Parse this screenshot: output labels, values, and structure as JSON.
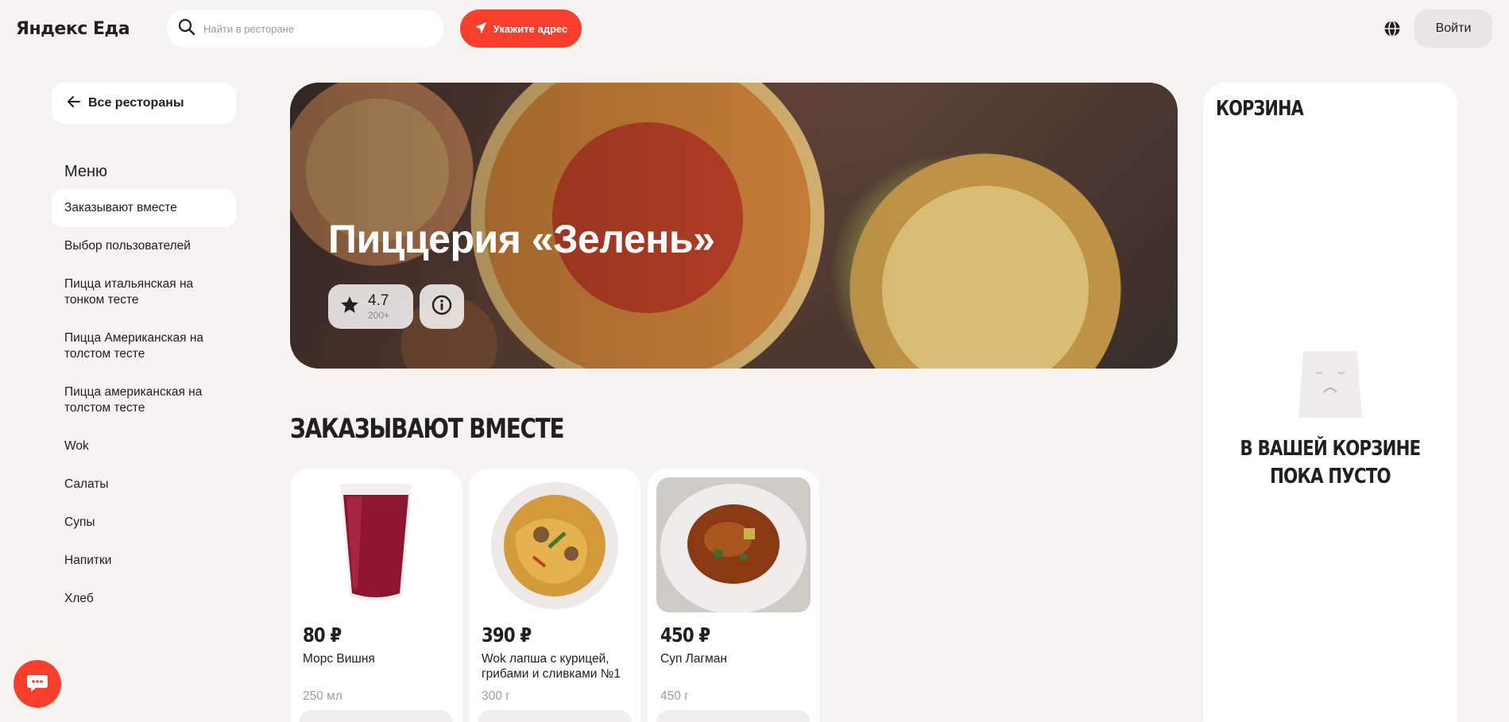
{
  "header": {
    "logo_text": "Яндекс Еда",
    "search_placeholder": "Найти в ресторане",
    "address_button": "Укажите адрес",
    "login_button": "Войти"
  },
  "sidebar": {
    "back_label": "Все рестораны",
    "menu_title": "Меню",
    "items": [
      {
        "label": "Заказывают вместе",
        "active": true
      },
      {
        "label": "Выбор пользователей"
      },
      {
        "label": "Пицца итальянская на тонком тесте"
      },
      {
        "label": "Пицца Американская на толстом тесте"
      },
      {
        "label": "Пицца американская на толстом тесте"
      },
      {
        "label": "Wok"
      },
      {
        "label": "Салаты"
      },
      {
        "label": "Супы"
      },
      {
        "label": "Напитки"
      },
      {
        "label": "Хлеб"
      }
    ]
  },
  "restaurant": {
    "title": "Пиццерия «Зелень»",
    "rating": "4.7",
    "rating_count": "200+"
  },
  "section": {
    "title": "ЗАКАЗЫВАЮТ ВМЕСТЕ",
    "products": [
      {
        "price": "80 ₽",
        "name": "Морс Вишня",
        "weight": "250 мл"
      },
      {
        "price": "390 ₽",
        "name": "Wok лапша с курицей, грибами и сливками №1",
        "weight": "300 г"
      },
      {
        "price": "450 ₽",
        "name": "Суп Лагман",
        "weight": "450 г"
      }
    ]
  },
  "cart": {
    "title": "КОРЗИНА",
    "empty_line1": "В ВАШЕЙ КОРЗИНЕ",
    "empty_line2": "ПОКА ПУСТО"
  },
  "colors": {
    "accent": "#fa3e2c",
    "background": "#f5f4f2",
    "text": "#21201f",
    "muted": "#9e9b98"
  },
  "icons": [
    "search-icon",
    "navigation-arrow-icon",
    "globe-icon",
    "arrow-left-icon",
    "star-icon",
    "info-icon",
    "sad-bag-icon",
    "chat-icon"
  ]
}
